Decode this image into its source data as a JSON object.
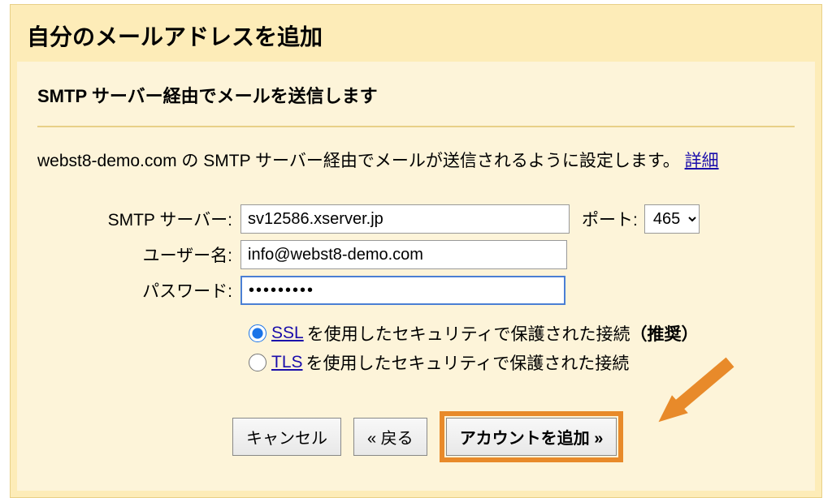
{
  "header": {
    "title": "自分のメールアドレスを追加"
  },
  "section": {
    "title": "SMTP サーバー経由でメールを送信します",
    "description_prefix": "webst8-demo.com の SMTP サーバー経由でメールが送信されるように設定します。",
    "detail_link": "詳細"
  },
  "form": {
    "smtp_label": "SMTP サーバー:",
    "smtp_value": "sv12586.xserver.jp",
    "port_label": "ポート:",
    "port_value": "465",
    "username_label": "ユーザー名:",
    "username_value": "info@webst8-demo.com",
    "password_label": "パスワード:",
    "password_value": "•••••••••"
  },
  "security": {
    "ssl_link": "SSL",
    "ssl_text": " を使用したセキュリティで保護された接続 ",
    "ssl_recommended": "（推奨）",
    "tls_link": "TLS",
    "tls_text": " を使用したセキュリティで保護された接続"
  },
  "buttons": {
    "cancel": "キャンセル",
    "back": "« 戻る",
    "add": "アカウントを追加 »"
  }
}
